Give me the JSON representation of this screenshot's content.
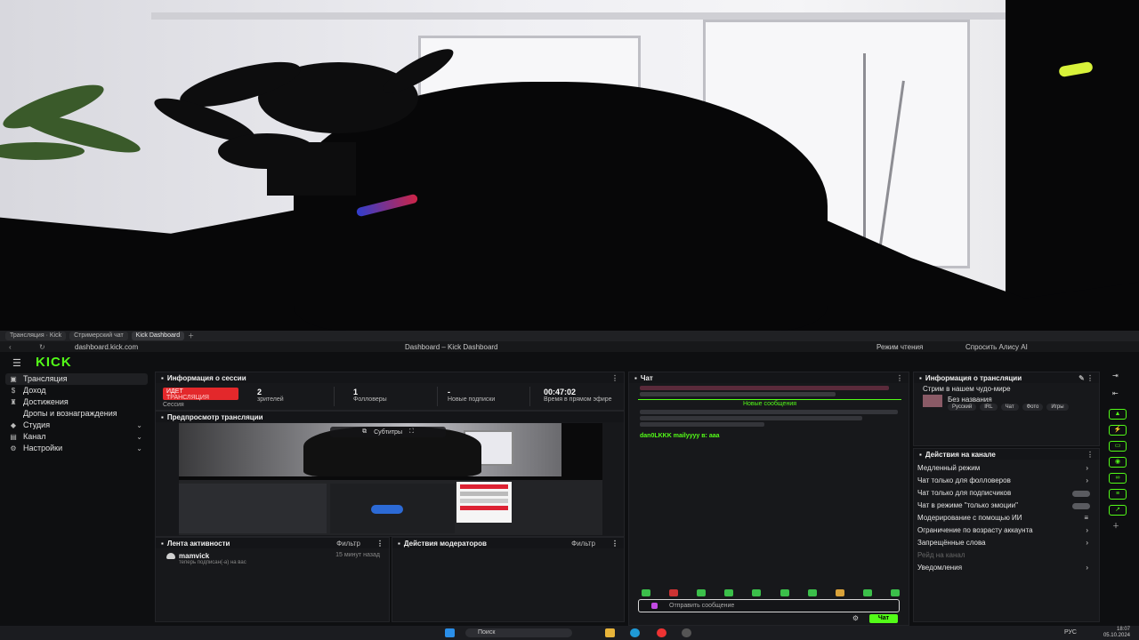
{
  "browser": {
    "tabs": [
      "Трансляция · Kick",
      "Стримерский чат",
      "Kick Dashboard"
    ],
    "url": "dashboard.kick.com",
    "title": "Dashboard – Kick Dashboard",
    "right1": "Режим чтения",
    "right2": "Спросить Алису AI"
  },
  "app": {
    "logo": "KICK",
    "sidebar": [
      {
        "label": "Трансляция",
        "icon": "broadcast-icon"
      },
      {
        "label": "Доход",
        "icon": "money-icon"
      },
      {
        "label": "Достижения",
        "icon": "trophy-icon"
      },
      {
        "label": "Дропы и вознаграждения",
        "icon": "gift-icon"
      },
      {
        "label": "Студия",
        "icon": "studio-icon"
      },
      {
        "label": "Канал",
        "icon": "channel-icon"
      },
      {
        "label": "Настройки",
        "icon": "gear-icon"
      }
    ],
    "session": {
      "title": "Информация о сессии",
      "badge": "ИДЕТ",
      "badge_sub": "ТРАНСЛЯЦИЯ",
      "session_label": "Сессия",
      "stats": [
        {
          "value": "2",
          "label": "зрителей"
        },
        {
          "value": "1",
          "label": "Фолловеры"
        },
        {
          "value": "-",
          "label": "Новые подписки"
        },
        {
          "value": "00:47:02",
          "label": "Время в прямом эфире"
        }
      ]
    },
    "preview": {
      "title": "Предпросмотр трансляции",
      "control": "Субтитры"
    },
    "feed": {
      "title": "Лента активности",
      "filter": "Фильтр",
      "user": "mamvick",
      "time": "15 минут назад",
      "desc": "теперь подписан(-а) на вас"
    },
    "mods": {
      "title": "Действия модераторов",
      "filter": "Фильтр"
    },
    "chat": {
      "title": "Чат",
      "new_messages": "Новые сообщения",
      "message": "dan0LKKK mailyyyy в: ааа",
      "placeholder": "Отправить сообщение",
      "send": "Чат"
    },
    "info": {
      "title": "Информация о трансляции",
      "stream_title": "Стрим в нашем чудо-мире",
      "name": "Без названия",
      "tags": [
        "Русский",
        "IRL",
        "Чат",
        "Фото",
        "Игры"
      ]
    },
    "actions": {
      "title": "Действия на канале",
      "rows": [
        {
          "label": "Медленный режим",
          "kind": "arrow"
        },
        {
          "label": "Чат только для фолловеров",
          "kind": "arrow"
        },
        {
          "label": "Чат только для подписчиков",
          "kind": "switch"
        },
        {
          "label": "Чат в режиме \"только эмоции\"",
          "kind": "switch"
        },
        {
          "label": "Модерирование с помощью ИИ",
          "kind": "icon"
        },
        {
          "label": "Ограничение по возрасту аккаунта",
          "kind": "arrow"
        },
        {
          "label": "Запрещённые слова",
          "kind": "arrow"
        },
        {
          "label": "Рейд на канал",
          "kind": "dim"
        },
        {
          "label": "Уведомления",
          "kind": "arrow"
        }
      ]
    }
  },
  "taskbar": {
    "search": "Поиск",
    "time": "18:07",
    "date": "05.10.2024",
    "lang": "РУС"
  }
}
